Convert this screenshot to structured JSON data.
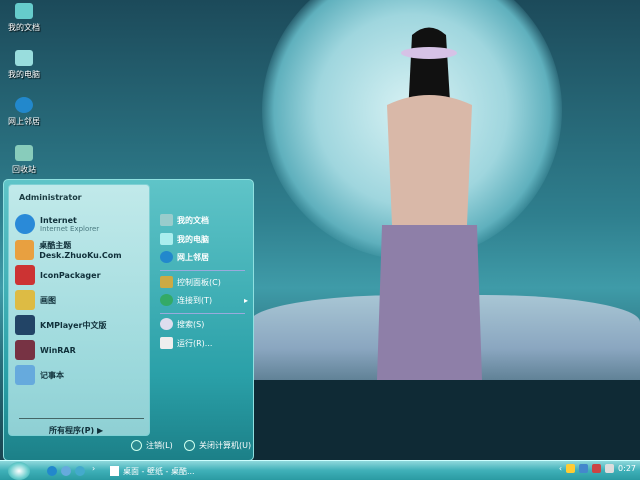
{
  "desktop": {
    "icons": [
      {
        "label": "我的文档",
        "icon": "folder-icon"
      },
      {
        "label": "我的电脑",
        "icon": "computer-icon"
      },
      {
        "label": "网上邻居",
        "icon": "network-globe-icon"
      },
      {
        "label": "回收站",
        "icon": "recycle-bin-icon"
      }
    ]
  },
  "start_menu": {
    "user": "Administrator",
    "pinned": [
      {
        "label": "Internet",
        "sub": "Internet Explorer",
        "icon": "ie-icon"
      },
      {
        "label": "桌酷主题Desk.ZhuoKu.Com",
        "icon": "theme-icon"
      },
      {
        "label": "IconPackager",
        "icon": "iconpackager-icon"
      },
      {
        "label": "画图",
        "icon": "paint-icon"
      },
      {
        "label": "KMPlayer中文版",
        "icon": "kmplayer-icon"
      },
      {
        "label": "WinRAR",
        "icon": "winrar-icon"
      },
      {
        "label": "记事本",
        "icon": "notepad-icon"
      }
    ],
    "all_programs": "所有程序(P)",
    "right": [
      {
        "label": "我的文档",
        "bold": true
      },
      {
        "label": "我的电脑",
        "bold": true
      },
      {
        "label": "网上邻居",
        "bold": true
      },
      {
        "label": "控制面板(C)"
      },
      {
        "label": "连接到(T)",
        "arrow": true
      },
      {
        "label": "搜索(S)"
      },
      {
        "label": "运行(R)..."
      }
    ],
    "logoff": "注销(L)",
    "shutdown": "关闭计算机(U)"
  },
  "taskbar": {
    "task": "桌面 - 壁纸 - 桌酷...",
    "clock": "0:27",
    "arrow": "›"
  },
  "colors": {
    "accent": "#2aa0a8",
    "taskbar": "#3fb0b8"
  }
}
